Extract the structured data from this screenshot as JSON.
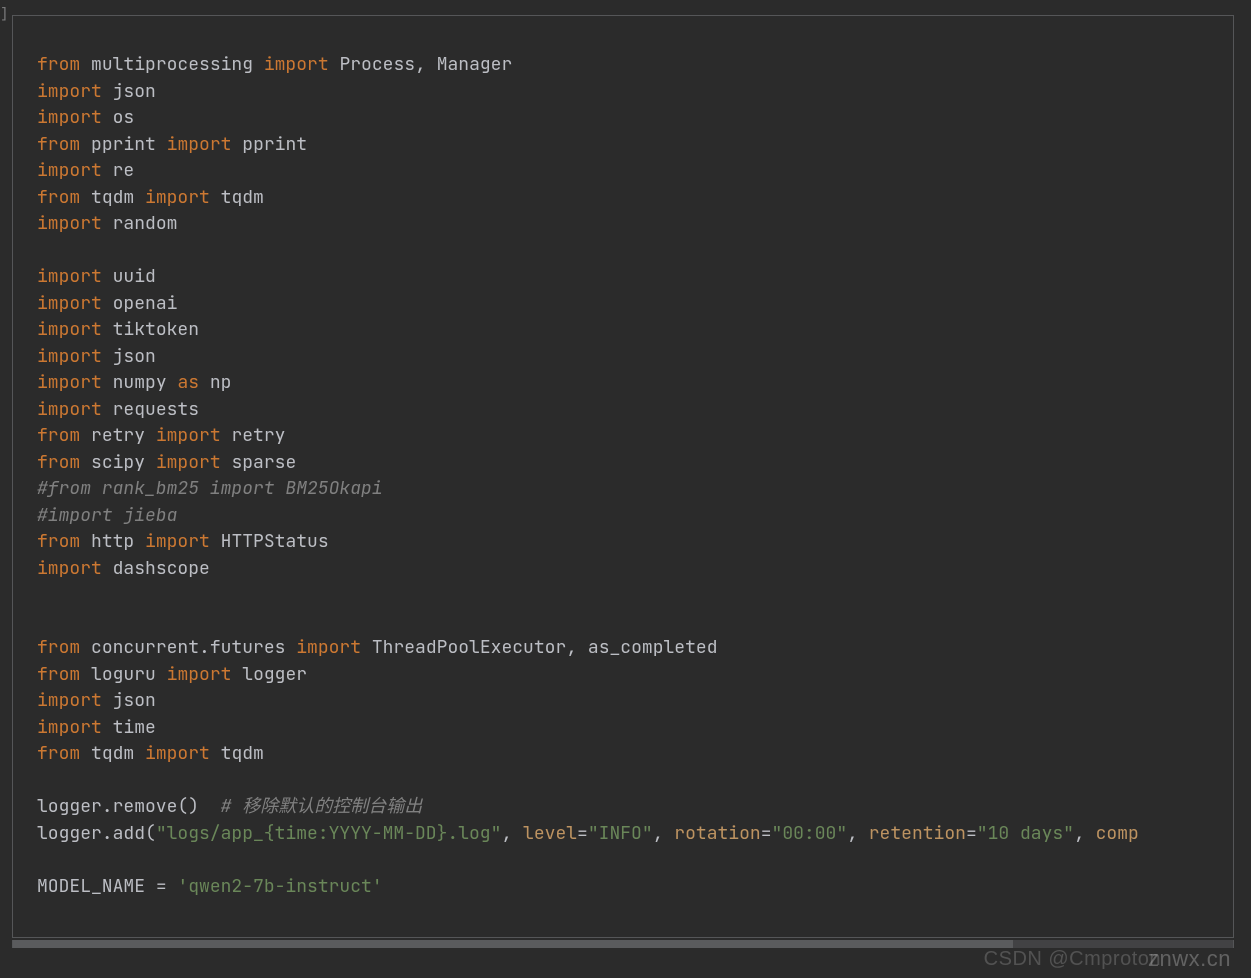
{
  "gutter": {
    "marker": "]"
  },
  "scrollbar": {
    "thumb_percent": 82
  },
  "watermarks": {
    "front": "znwx.cn",
    "back": "CSDN @Cmproton"
  },
  "code": {
    "lines": [
      {
        "type": "code",
        "tokens": [
          {
            "cls": "kw",
            "t": "from"
          },
          {
            "cls": "sp",
            "t": " "
          },
          {
            "cls": "ident",
            "t": "multiprocessing"
          },
          {
            "cls": "sp",
            "t": " "
          },
          {
            "cls": "kw",
            "t": "import"
          },
          {
            "cls": "sp",
            "t": " "
          },
          {
            "cls": "ident",
            "t": "Process"
          },
          {
            "cls": "op",
            "t": ","
          },
          {
            "cls": "sp",
            "t": " "
          },
          {
            "cls": "ident",
            "t": "Manager"
          }
        ]
      },
      {
        "type": "code",
        "tokens": [
          {
            "cls": "kw",
            "t": "import"
          },
          {
            "cls": "sp",
            "t": " "
          },
          {
            "cls": "ident",
            "t": "json"
          }
        ]
      },
      {
        "type": "code",
        "tokens": [
          {
            "cls": "kw",
            "t": "import"
          },
          {
            "cls": "sp",
            "t": " "
          },
          {
            "cls": "ident",
            "t": "os"
          }
        ]
      },
      {
        "type": "code",
        "tokens": [
          {
            "cls": "kw",
            "t": "from"
          },
          {
            "cls": "sp",
            "t": " "
          },
          {
            "cls": "ident",
            "t": "pprint"
          },
          {
            "cls": "sp",
            "t": " "
          },
          {
            "cls": "kw",
            "t": "import"
          },
          {
            "cls": "sp",
            "t": " "
          },
          {
            "cls": "ident",
            "t": "pprint"
          }
        ]
      },
      {
        "type": "code",
        "tokens": [
          {
            "cls": "kw",
            "t": "import"
          },
          {
            "cls": "sp",
            "t": " "
          },
          {
            "cls": "ident",
            "t": "re"
          }
        ]
      },
      {
        "type": "code",
        "tokens": [
          {
            "cls": "kw",
            "t": "from"
          },
          {
            "cls": "sp",
            "t": " "
          },
          {
            "cls": "ident",
            "t": "tqdm"
          },
          {
            "cls": "sp",
            "t": " "
          },
          {
            "cls": "kw",
            "t": "import"
          },
          {
            "cls": "sp",
            "t": " "
          },
          {
            "cls": "ident",
            "t": "tqdm"
          }
        ]
      },
      {
        "type": "code",
        "tokens": [
          {
            "cls": "kw",
            "t": "import"
          },
          {
            "cls": "sp",
            "t": " "
          },
          {
            "cls": "ident",
            "t": "random"
          }
        ]
      },
      {
        "type": "blank"
      },
      {
        "type": "code",
        "tokens": [
          {
            "cls": "kw",
            "t": "import"
          },
          {
            "cls": "sp",
            "t": " "
          },
          {
            "cls": "ident",
            "t": "uuid"
          }
        ]
      },
      {
        "type": "code",
        "tokens": [
          {
            "cls": "kw",
            "t": "import"
          },
          {
            "cls": "sp",
            "t": " "
          },
          {
            "cls": "ident",
            "t": "openai"
          }
        ]
      },
      {
        "type": "code",
        "tokens": [
          {
            "cls": "kw",
            "t": "import"
          },
          {
            "cls": "sp",
            "t": " "
          },
          {
            "cls": "ident",
            "t": "tiktoken"
          }
        ]
      },
      {
        "type": "code",
        "tokens": [
          {
            "cls": "kw",
            "t": "import"
          },
          {
            "cls": "sp",
            "t": " "
          },
          {
            "cls": "ident",
            "t": "json"
          }
        ]
      },
      {
        "type": "code",
        "tokens": [
          {
            "cls": "kw",
            "t": "import"
          },
          {
            "cls": "sp",
            "t": " "
          },
          {
            "cls": "ident",
            "t": "numpy"
          },
          {
            "cls": "sp",
            "t": " "
          },
          {
            "cls": "kw",
            "t": "as"
          },
          {
            "cls": "sp",
            "t": " "
          },
          {
            "cls": "ident",
            "t": "np"
          }
        ]
      },
      {
        "type": "code",
        "tokens": [
          {
            "cls": "kw",
            "t": "import"
          },
          {
            "cls": "sp",
            "t": " "
          },
          {
            "cls": "ident",
            "t": "requests"
          }
        ]
      },
      {
        "type": "code",
        "tokens": [
          {
            "cls": "kw",
            "t": "from"
          },
          {
            "cls": "sp",
            "t": " "
          },
          {
            "cls": "ident",
            "t": "retry"
          },
          {
            "cls": "sp",
            "t": " "
          },
          {
            "cls": "kw",
            "t": "import"
          },
          {
            "cls": "sp",
            "t": " "
          },
          {
            "cls": "ident",
            "t": "retry"
          }
        ]
      },
      {
        "type": "code",
        "tokens": [
          {
            "cls": "kw",
            "t": "from"
          },
          {
            "cls": "sp",
            "t": " "
          },
          {
            "cls": "ident",
            "t": "scipy"
          },
          {
            "cls": "sp",
            "t": " "
          },
          {
            "cls": "kw",
            "t": "import"
          },
          {
            "cls": "sp",
            "t": " "
          },
          {
            "cls": "ident",
            "t": "sparse"
          }
        ]
      },
      {
        "type": "comment",
        "text": "#from rank_bm25 import BM25Okapi"
      },
      {
        "type": "comment",
        "text": "#import jieba"
      },
      {
        "type": "code",
        "tokens": [
          {
            "cls": "kw",
            "t": "from"
          },
          {
            "cls": "sp",
            "t": " "
          },
          {
            "cls": "ident",
            "t": "http"
          },
          {
            "cls": "sp",
            "t": " "
          },
          {
            "cls": "kw",
            "t": "import"
          },
          {
            "cls": "sp",
            "t": " "
          },
          {
            "cls": "ident",
            "t": "HTTPStatus"
          }
        ]
      },
      {
        "type": "code",
        "tokens": [
          {
            "cls": "kw",
            "t": "import"
          },
          {
            "cls": "sp",
            "t": " "
          },
          {
            "cls": "ident",
            "t": "dashscope"
          }
        ]
      },
      {
        "type": "blank"
      },
      {
        "type": "blank"
      },
      {
        "type": "code",
        "tokens": [
          {
            "cls": "kw",
            "t": "from"
          },
          {
            "cls": "sp",
            "t": " "
          },
          {
            "cls": "ident",
            "t": "concurrent.futures"
          },
          {
            "cls": "sp",
            "t": " "
          },
          {
            "cls": "kw",
            "t": "import"
          },
          {
            "cls": "sp",
            "t": " "
          },
          {
            "cls": "ident",
            "t": "ThreadPoolExecutor"
          },
          {
            "cls": "op",
            "t": ","
          },
          {
            "cls": "sp",
            "t": " "
          },
          {
            "cls": "ident",
            "t": "as_completed"
          }
        ]
      },
      {
        "type": "code",
        "tokens": [
          {
            "cls": "kw",
            "t": "from"
          },
          {
            "cls": "sp",
            "t": " "
          },
          {
            "cls": "ident",
            "t": "loguru"
          },
          {
            "cls": "sp",
            "t": " "
          },
          {
            "cls": "kw",
            "t": "import"
          },
          {
            "cls": "sp",
            "t": " "
          },
          {
            "cls": "ident",
            "t": "logger"
          }
        ]
      },
      {
        "type": "code",
        "tokens": [
          {
            "cls": "kw",
            "t": "import"
          },
          {
            "cls": "sp",
            "t": " "
          },
          {
            "cls": "ident",
            "t": "json"
          }
        ]
      },
      {
        "type": "code",
        "tokens": [
          {
            "cls": "kw",
            "t": "import"
          },
          {
            "cls": "sp",
            "t": " "
          },
          {
            "cls": "ident",
            "t": "time"
          }
        ]
      },
      {
        "type": "code",
        "tokens": [
          {
            "cls": "kw",
            "t": "from"
          },
          {
            "cls": "sp",
            "t": " "
          },
          {
            "cls": "ident",
            "t": "tqdm"
          },
          {
            "cls": "sp",
            "t": " "
          },
          {
            "cls": "kw",
            "t": "import"
          },
          {
            "cls": "sp",
            "t": " "
          },
          {
            "cls": "ident",
            "t": "tqdm"
          }
        ]
      },
      {
        "type": "blank"
      },
      {
        "type": "code",
        "tokens": [
          {
            "cls": "ident",
            "t": "logger.remove()"
          },
          {
            "cls": "sp",
            "t": "  "
          },
          {
            "cls": "comment",
            "t": "# 移除默认的控制台输出"
          }
        ]
      },
      {
        "type": "code",
        "tokens": [
          {
            "cls": "ident",
            "t": "logger.add("
          },
          {
            "cls": "str",
            "t": "\"logs/app_{time:YYYY-MM-DD}.log\""
          },
          {
            "cls": "op",
            "t": ","
          },
          {
            "cls": "sp",
            "t": " "
          },
          {
            "cls": "param",
            "t": "level"
          },
          {
            "cls": "op",
            "t": "="
          },
          {
            "cls": "str",
            "t": "\"INFO\""
          },
          {
            "cls": "op",
            "t": ","
          },
          {
            "cls": "sp",
            "t": " "
          },
          {
            "cls": "param",
            "t": "rotation"
          },
          {
            "cls": "op",
            "t": "="
          },
          {
            "cls": "str",
            "t": "\"00:00\""
          },
          {
            "cls": "op",
            "t": ","
          },
          {
            "cls": "sp",
            "t": " "
          },
          {
            "cls": "param",
            "t": "retention"
          },
          {
            "cls": "op",
            "t": "="
          },
          {
            "cls": "str",
            "t": "\"10 days\""
          },
          {
            "cls": "op",
            "t": ","
          },
          {
            "cls": "sp",
            "t": " "
          },
          {
            "cls": "param",
            "t": "comp"
          }
        ]
      },
      {
        "type": "blank"
      },
      {
        "type": "code",
        "tokens": [
          {
            "cls": "ident",
            "t": "MODEL_NAME "
          },
          {
            "cls": "op",
            "t": "="
          },
          {
            "cls": "sp",
            "t": " "
          },
          {
            "cls": "str",
            "t": "'qwen2-7b-instruct'"
          }
        ]
      }
    ]
  }
}
